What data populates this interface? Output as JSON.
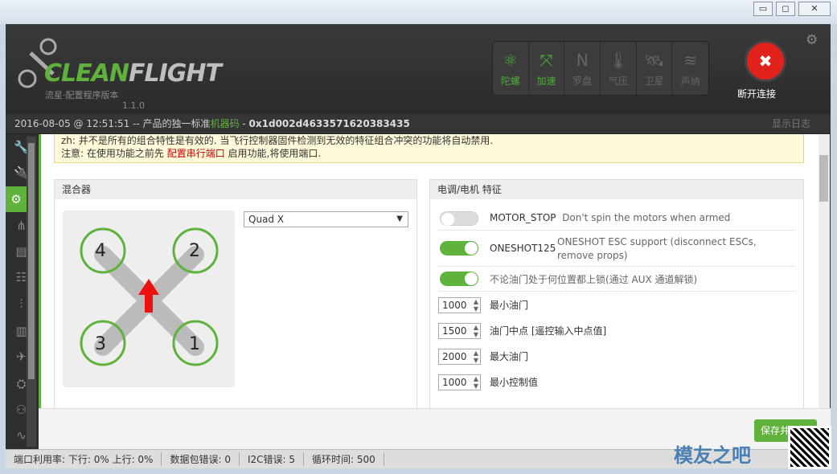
{
  "window": {
    "min": "▭",
    "max": "◻",
    "close": "✕"
  },
  "app": {
    "brand_a": "CLEAN",
    "brand_b": "FLIGHT",
    "subtitle": "流星·配置程序版本",
    "version": "1.1.0"
  },
  "sensors": [
    {
      "label": "陀螺",
      "icon": "gyro-icon",
      "glyph": "⚛",
      "active": true
    },
    {
      "label": "加速",
      "icon": "accel-icon",
      "glyph": "⤧",
      "active": true
    },
    {
      "label": "罗盘",
      "icon": "compass-icon",
      "glyph": "N",
      "active": false
    },
    {
      "label": "气压",
      "icon": "barometer-icon",
      "glyph": "🌡",
      "active": false
    },
    {
      "label": "卫星",
      "icon": "gps-icon",
      "glyph": "🛰",
      "active": false
    },
    {
      "label": "声纳",
      "icon": "sonar-icon",
      "glyph": "≋",
      "active": false
    }
  ],
  "connect": {
    "label": "断开连接",
    "glyph": "✖"
  },
  "info": {
    "datetime": "2016-08-05 @ 12:51:51",
    "sep": " -- 产品的独一标准",
    "machine_label": "机器码",
    "dash": " - ",
    "machine_id": "0x1d002d4633571620383435"
  },
  "show_log": "显示日志",
  "note": {
    "line1": "zh: 并不是所有的组合特性是有效的. 当飞行控制器固件检测到无效的特征组合冲突的功能将自动禁用.",
    "line2_a": "注意: 在使用功能之前先 ",
    "line2_link": "配置串行端口",
    "line2_b": " 启用功能,将使用端口."
  },
  "mixer": {
    "title": "混合器",
    "selected": "Quad X",
    "motors": [
      "4",
      "2",
      "3",
      "1"
    ]
  },
  "esc": {
    "title": "电调/电机 特征",
    "toggles": [
      {
        "name": "MOTOR_STOP",
        "desc": "Don't spin the motors when armed",
        "on": false
      },
      {
        "name": "ONESHOT125",
        "desc": "ONESHOT ESC support (disconnect ESCs, remove props)",
        "on": true
      },
      {
        "name": "",
        "desc": "不论油门处于何位置都上锁(通过 AUX 通道解锁)",
        "on": true
      }
    ],
    "numbers": [
      {
        "value": "1000",
        "label": "最小油门"
      },
      {
        "value": "1500",
        "label": "油门中点 [遥控输入中点值]"
      },
      {
        "value": "2000",
        "label": "最大油门"
      },
      {
        "value": "1000",
        "label": "最小控制值"
      }
    ]
  },
  "save": "保存并",
  "status": {
    "port": "端口利用率: 下行: 0% 上行: 0%",
    "packet": "数据包错误: 0",
    "i2c": "I2C错误: 5",
    "cycle": "循环时间: 500"
  },
  "watermark": "模友之吧",
  "colors": {
    "accent": "#5fb23b",
    "danger": "#e1221c"
  }
}
